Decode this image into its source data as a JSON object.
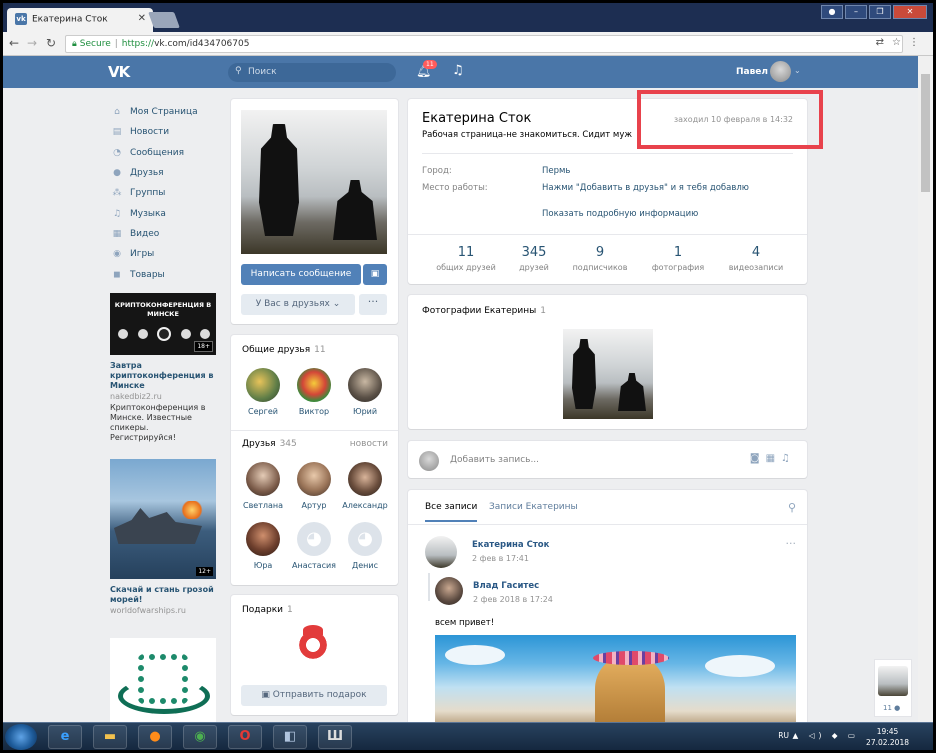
{
  "browser": {
    "tab_title": "Екатерина Сток",
    "tab_close": "✕",
    "security_label": "Secure",
    "url_scheme": "https://",
    "url_rest": "vk.com/id434706705"
  },
  "vk_header": {
    "logo": "VK",
    "search_placeholder": "Поиск",
    "notifications_count": "11",
    "user_name": "Павел"
  },
  "sidebar": {
    "items": [
      {
        "label": "Моя Страница",
        "icon": "home-icon"
      },
      {
        "label": "Новости",
        "icon": "news-icon"
      },
      {
        "label": "Сообщения",
        "icon": "messages-icon"
      },
      {
        "label": "Друзья",
        "icon": "friends-icon"
      },
      {
        "label": "Группы",
        "icon": "groups-icon"
      },
      {
        "label": "Музыка",
        "icon": "music-icon"
      },
      {
        "label": "Видео",
        "icon": "video-icon"
      },
      {
        "label": "Игры",
        "icon": "games-icon"
      },
      {
        "label": "Товары",
        "icon": "goods-icon"
      }
    ]
  },
  "ads": [
    {
      "banner_text": "КРИПТОКОНФЕРЕНЦИЯ В МИНСКЕ",
      "age": "18+",
      "title": "Завтра криптоконференция в Минске",
      "domain": "nakedbiz2.ru",
      "description": "Криптоконференция в Минске. Известные спикеры. Регистрируйся!"
    },
    {
      "age": "12+",
      "title": "Скачай и стань грозой морей!",
      "domain": "worldofwarships.ru"
    }
  ],
  "profile": {
    "name": "Екатерина Сток",
    "status": "Рабочая страница-не знакомиться. Сидит муж",
    "last_seen": "заходил 10 февраля в 14:32",
    "info": [
      {
        "label": "Город:",
        "value": "Пермь"
      },
      {
        "label": "Место работы:",
        "value": "Нажми \"Добавить в друзья\" и я тебя добавлю"
      }
    ],
    "show_more": "Показать подробную информацию",
    "counters": [
      {
        "num": "11",
        "label": "общих друзей"
      },
      {
        "num": "345",
        "label": "друзей"
      },
      {
        "num": "9",
        "label": "подписчиков"
      },
      {
        "num": "1",
        "label": "фотография"
      },
      {
        "num": "4",
        "label": "видеозаписи"
      }
    ]
  },
  "actions": {
    "write_message": "Написать сообщение",
    "in_friends": "У Вас в друзьях",
    "more": "···",
    "send_gift": "Отправить подарок"
  },
  "mutual_friends": {
    "title": "Общие друзья",
    "count": "11",
    "people": [
      "Сергей",
      "Виктор",
      "Юрий"
    ]
  },
  "friends": {
    "title": "Друзья",
    "count": "345",
    "link": "новости",
    "people": [
      "Светлана",
      "Артур",
      "Александр",
      "Юра",
      "Анастасия",
      "Денис"
    ]
  },
  "gifts": {
    "title": "Подарки",
    "count": "1"
  },
  "photos": {
    "title": "Фотографии Екатерины",
    "count": "1"
  },
  "post_box": {
    "placeholder": "Добавить запись..."
  },
  "wall": {
    "tabs": [
      "Все записи",
      "Записи Екатерины"
    ],
    "post": {
      "author": "Екатерина Сток",
      "date": "2 фев в 17:41",
      "repost_author": "Влад Гаситес",
      "repost_date": "2 фев 2018 в 17:24",
      "text": "всем привет!"
    }
  },
  "mini_widget": {
    "count": "11"
  },
  "taskbar": {
    "lang": "RU",
    "time": "19:45",
    "date": "27.02.2018"
  },
  "colors": {
    "vk_blue": "#4a76a8",
    "button_blue": "#5181b8",
    "highlight_red": "#e8424c",
    "link": "#285473"
  }
}
